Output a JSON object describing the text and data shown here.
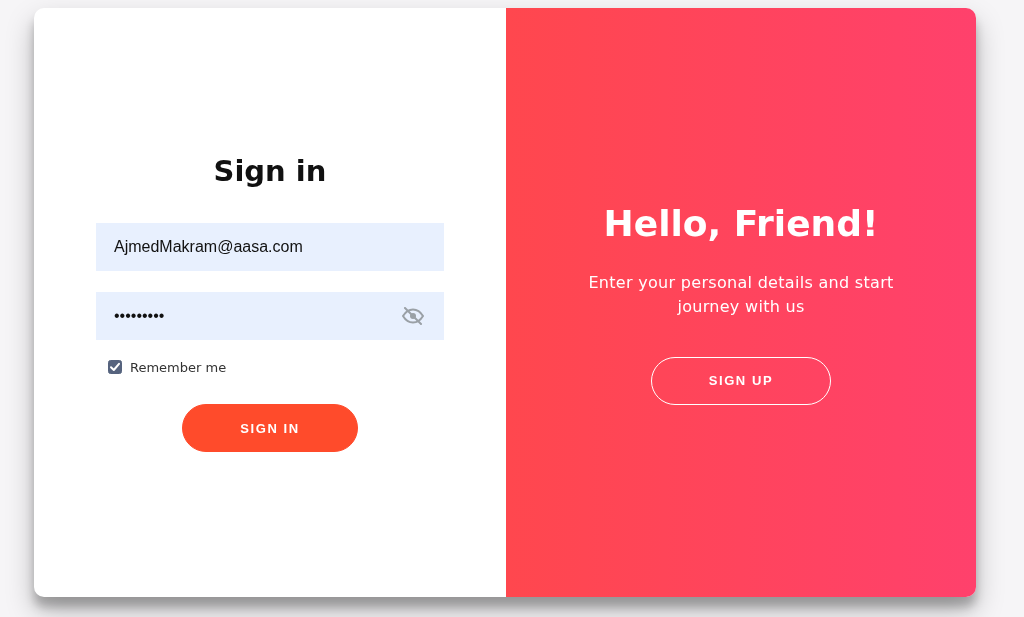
{
  "sign_in": {
    "title": "Sign in",
    "email": {
      "value": "AjmedMakram@aasa.com"
    },
    "password": {
      "value": "•••••••••",
      "masked": true
    },
    "remember_me": {
      "label": "Remember me",
      "checked": true
    },
    "button": "SIGN IN"
  },
  "overlay": {
    "title": "Hello, Friend!",
    "text": "Enter your personal details and start journey with us",
    "button": "SIGN UP"
  }
}
